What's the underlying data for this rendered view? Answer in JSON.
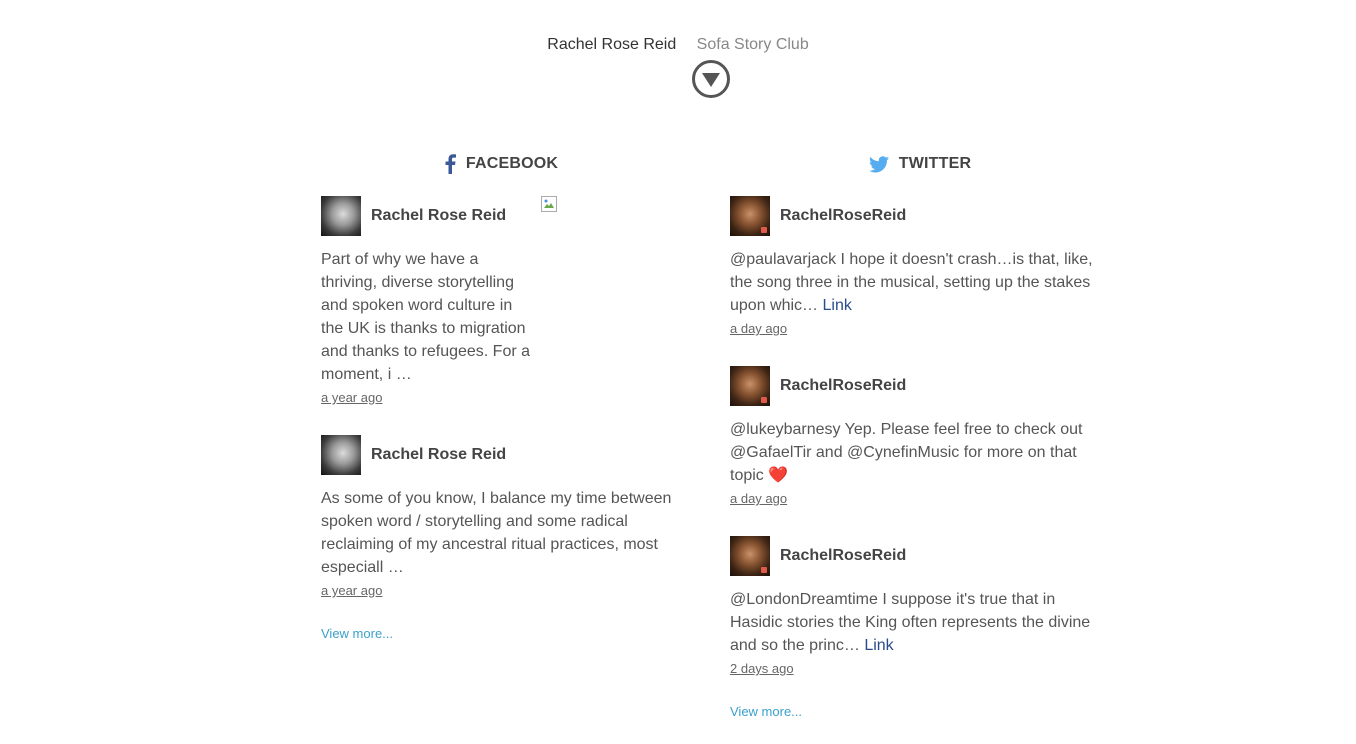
{
  "nav": {
    "primary": "Rachel Rose Reid",
    "secondary": "Sofa Story Club"
  },
  "facebook": {
    "heading": "FACEBOOK",
    "posts": [
      {
        "author": "Rachel Rose Reid",
        "text": "Part of why we have a thriving, diverse storytelling and spoken word culture in the UK is thanks to migration and thanks to refugees. For a moment, i …",
        "time": "a year ago"
      },
      {
        "author": "Rachel Rose Reid",
        "text": "As some of you know, I balance my time between spoken word / storytelling and some radical reclaiming of my ancestral ritual practices, most especiall …",
        "time": "a year ago"
      }
    ],
    "view_more": "View more..."
  },
  "twitter": {
    "heading": "TWITTER",
    "posts": [
      {
        "author": "RachelRoseReid",
        "text": "@paulavarjack I hope it doesn't crash…is that, like, the song three in the musical, setting up the stakes upon whic…",
        "link": "Link",
        "time": "a day ago"
      },
      {
        "author": "RachelRoseReid",
        "text": "@lukeybarnesy Yep. Please feel free to check out @GafaelTir and @CynefinMusic for more on that topic ❤️",
        "time": "a day ago"
      },
      {
        "author": "RachelRoseReid",
        "text": "@LondonDreamtime I suppose it's true that in Hasidic stories the King often represents the divine and so the princ…",
        "link": "Link",
        "time": "2 days ago"
      }
    ],
    "view_more": "View more..."
  },
  "icons": {
    "scroll_down": "chevron-down-circle-icon",
    "facebook": "facebook-icon",
    "twitter": "twitter-bird-icon",
    "broken_image": "broken-image-icon"
  },
  "colors": {
    "facebook_blue": "#3b5998",
    "twitter_blue": "#55acee",
    "link_blue": "#2a4b8d",
    "view_more": "#3aa0c9"
  }
}
